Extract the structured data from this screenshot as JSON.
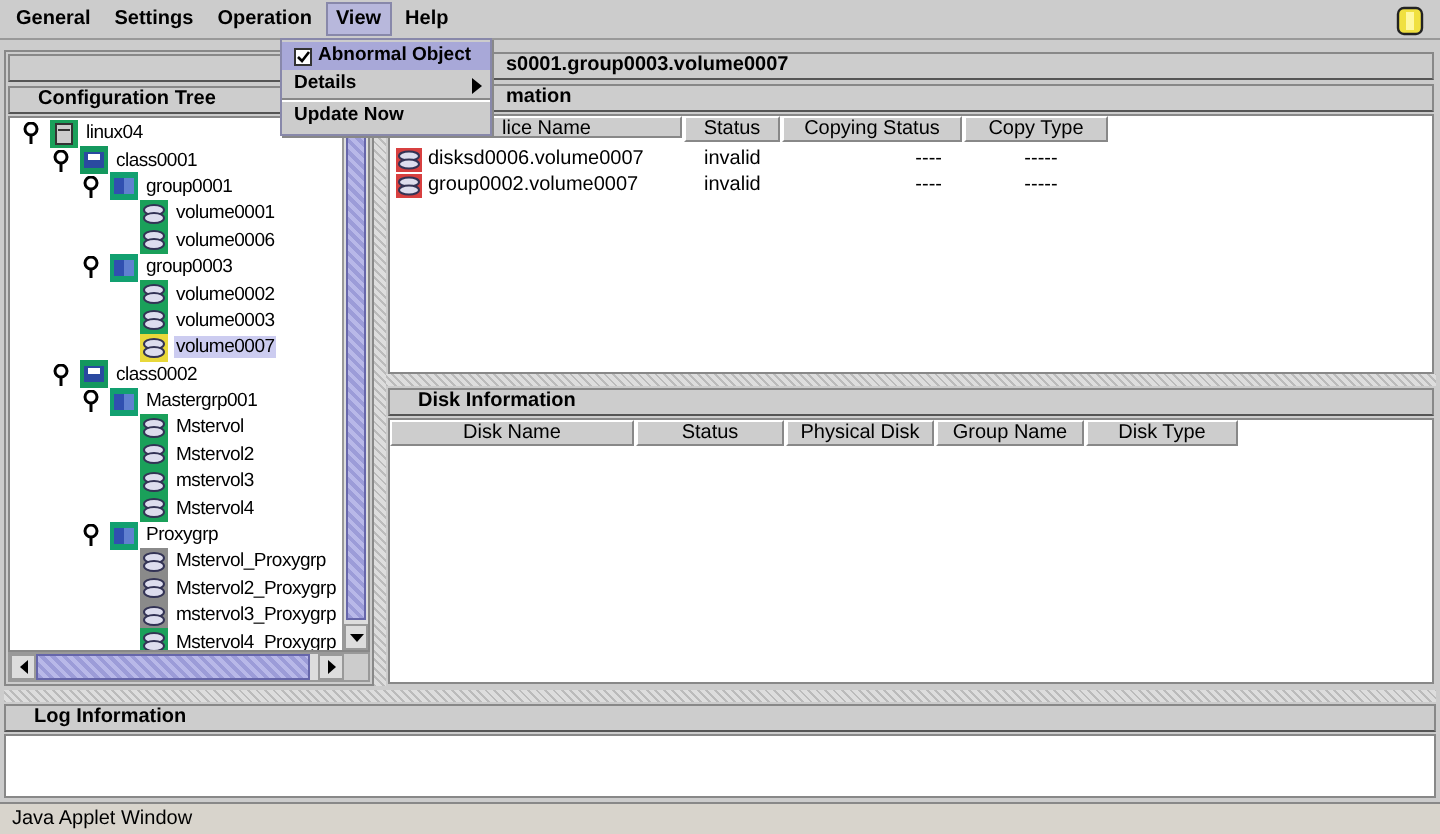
{
  "menu": [
    {
      "label": "General",
      "selected": false
    },
    {
      "label": "Settings",
      "selected": false
    },
    {
      "label": "Operation",
      "selected": false
    },
    {
      "label": "View",
      "selected": true
    },
    {
      "label": "Help",
      "selected": false
    }
  ],
  "view_menu": [
    {
      "label": "Abnormal Object",
      "kind": "check",
      "checked": true,
      "selected": true
    },
    {
      "label": "Details",
      "kind": "submenu",
      "selected": false
    },
    {
      "label": "Update Now",
      "kind": "item",
      "selected": false
    }
  ],
  "tree": {
    "title": "Configuration Tree",
    "items": [
      {
        "label": "linux04",
        "kind": "host",
        "expanded": true,
        "selected": false,
        "children": [
          {
            "label": "class0001",
            "kind": "class",
            "expanded": true,
            "selected": false,
            "children": [
              {
                "label": "group0001",
                "kind": "group",
                "expanded": true,
                "selected": false,
                "children": [
                  {
                    "label": "volume0001",
                    "kind": "volume",
                    "selected": false
                  },
                  {
                    "label": "volume0006",
                    "kind": "volume",
                    "selected": false
                  }
                ]
              },
              {
                "label": "group0003",
                "kind": "group",
                "expanded": true,
                "selected": false,
                "children": [
                  {
                    "label": "volume0002",
                    "kind": "volume",
                    "selected": false
                  },
                  {
                    "label": "volume0003",
                    "kind": "volume",
                    "selected": false
                  },
                  {
                    "label": "volume0007",
                    "kind": "warn-volume",
                    "selected": true
                  }
                ]
              }
            ]
          },
          {
            "label": "class0002",
            "kind": "class",
            "expanded": true,
            "selected": false,
            "children": [
              {
                "label": "Mastergrp001",
                "kind": "group",
                "expanded": true,
                "selected": false,
                "children": [
                  {
                    "label": "Mstervol",
                    "kind": "volume",
                    "selected": false
                  },
                  {
                    "label": "Mstervol2",
                    "kind": "volume",
                    "selected": false
                  },
                  {
                    "label": "mstervol3",
                    "kind": "volume",
                    "selected": false
                  },
                  {
                    "label": "Mstervol4",
                    "kind": "volume",
                    "selected": false
                  }
                ]
              },
              {
                "label": "Proxygrp",
                "kind": "group",
                "expanded": true,
                "selected": false,
                "children": [
                  {
                    "label": "Mstervol_Proxygrp",
                    "kind": "proxy-volume",
                    "selected": false
                  },
                  {
                    "label": "Mstervol2_Proxygrp",
                    "kind": "proxy-volume",
                    "selected": false
                  },
                  {
                    "label": "mstervol3_Proxygrp",
                    "kind": "proxy-volume",
                    "selected": false
                  },
                  {
                    "label": "Mstervol4_Proxygrp",
                    "kind": "volume",
                    "selected": false
                  }
                ]
              }
            ]
          }
        ]
      }
    ]
  },
  "path_title": "s0001.group0003.volume0007",
  "slice_panel": {
    "title": "mation",
    "columns": [
      "lice Name",
      "Status",
      "Copying Status",
      "Copy Type"
    ],
    "rows": [
      {
        "cells": [
          "disksd0006.volume0007",
          "invalid",
          "----",
          "-----"
        ]
      },
      {
        "cells": [
          "group0002.volume0007",
          "invalid",
          "----",
          "-----"
        ]
      }
    ]
  },
  "disk_panel": {
    "title": "Disk Information",
    "columns": [
      "Disk Name",
      "Status",
      "Physical Disk",
      "Group Name",
      "Disk Type"
    ]
  },
  "log_panel": {
    "title": "Log Information"
  },
  "status_bar": "Java Applet Window"
}
